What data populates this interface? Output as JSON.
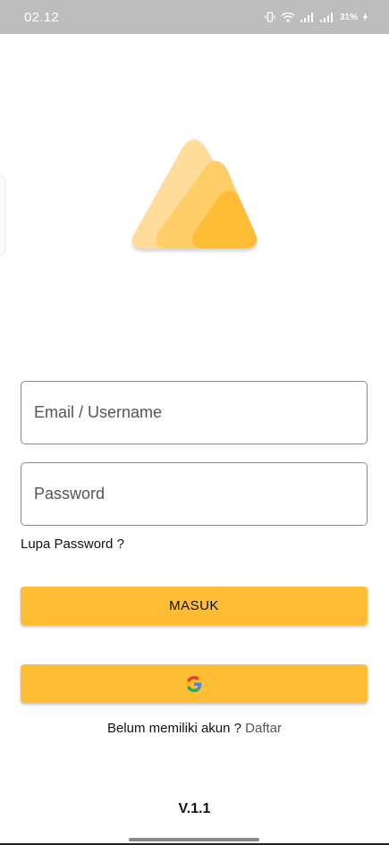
{
  "status_bar": {
    "time": "02.12",
    "battery": "31%",
    "icons": [
      "vibrate-icon",
      "wifi-icon",
      "signal-icon",
      "signal-icon",
      "battery-charging-icon"
    ]
  },
  "logo": {
    "icon": "triangle-logo-icon",
    "colors": [
      "#ffdc99",
      "#ffcd66",
      "#ffbd35"
    ]
  },
  "login_form": {
    "email_placeholder": "Email / Username",
    "password_placeholder": "Password",
    "forgot_password": "Lupa Password ?",
    "login_button": "MASUK",
    "google_button_icon": "google-icon"
  },
  "register": {
    "prompt": "Belum memiliki akun ? ",
    "link": "Daftar"
  },
  "version": "V.1.1",
  "colors": {
    "accent": "#ffbd35",
    "status_bar": "#bdbdbd"
  }
}
